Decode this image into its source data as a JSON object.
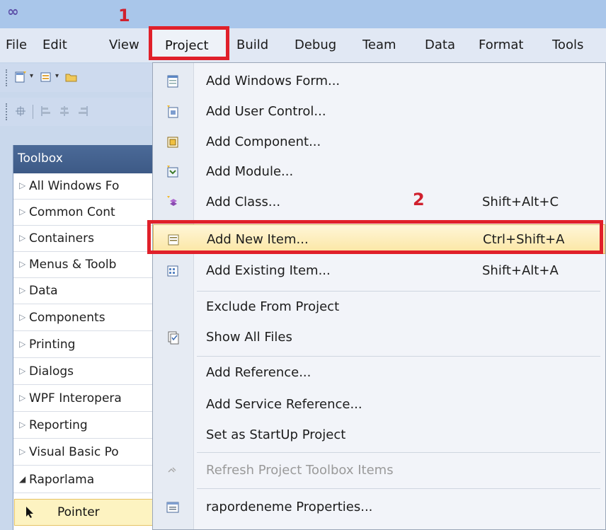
{
  "annotations": {
    "step1": "1",
    "step2": "2"
  },
  "menubar": {
    "items": [
      "File",
      "Edit",
      "View",
      "Project",
      "Build",
      "Debug",
      "Team",
      "Data",
      "Format",
      "Tools"
    ]
  },
  "toolbox": {
    "title": "Toolbox",
    "categories": [
      {
        "label": "All Windows Fo",
        "expanded": false
      },
      {
        "label": "Common Cont",
        "expanded": false
      },
      {
        "label": "Containers",
        "expanded": false
      },
      {
        "label": "Menus & Toolb",
        "expanded": false
      },
      {
        "label": "Data",
        "expanded": false
      },
      {
        "label": "Components",
        "expanded": false
      },
      {
        "label": "Printing",
        "expanded": false
      },
      {
        "label": "Dialogs",
        "expanded": false
      },
      {
        "label": "WPF Interopera",
        "expanded": false
      },
      {
        "label": "Reporting",
        "expanded": false
      },
      {
        "label": "Visual Basic Po",
        "expanded": false
      },
      {
        "label": "Raporlama",
        "expanded": true
      }
    ],
    "pointer_label": "Pointer"
  },
  "project_menu": {
    "items": [
      {
        "label": "Add Windows Form...",
        "shortcut": "",
        "icon": "windows-form-icon"
      },
      {
        "label": "Add User Control...",
        "shortcut": "",
        "icon": "user-control-icon"
      },
      {
        "label": "Add Component...",
        "shortcut": "",
        "icon": "component-icon"
      },
      {
        "label": "Add Module...",
        "shortcut": "",
        "icon": "module-icon"
      },
      {
        "label": "Add Class...",
        "shortcut": "Shift+Alt+C",
        "icon": "class-icon"
      },
      {
        "label": "Add New Item...",
        "shortcut": "Ctrl+Shift+A",
        "icon": "new-item-icon"
      },
      {
        "label": "Add Existing Item...",
        "shortcut": "Shift+Alt+A",
        "icon": "existing-item-icon"
      },
      {
        "label": "Exclude From Project",
        "shortcut": "",
        "icon": ""
      },
      {
        "label": "Show All Files",
        "shortcut": "",
        "icon": "show-all-files-icon"
      },
      {
        "label": "Add Reference...",
        "shortcut": "",
        "icon": ""
      },
      {
        "label": "Add Service Reference...",
        "shortcut": "",
        "icon": ""
      },
      {
        "label": "Set as StartUp Project",
        "shortcut": "",
        "icon": ""
      },
      {
        "label": "Refresh Project Toolbox Items",
        "shortcut": "",
        "icon": "refresh-icon",
        "disabled": true
      },
      {
        "label": "rapordeneme Properties...",
        "shortcut": "",
        "icon": "properties-icon"
      }
    ]
  },
  "colors": {
    "highlight_box": "#e0202a",
    "annotation_number": "#d0202e",
    "toolbox_header": "#4b6a98",
    "menu_hover": "#fbe6a2"
  }
}
